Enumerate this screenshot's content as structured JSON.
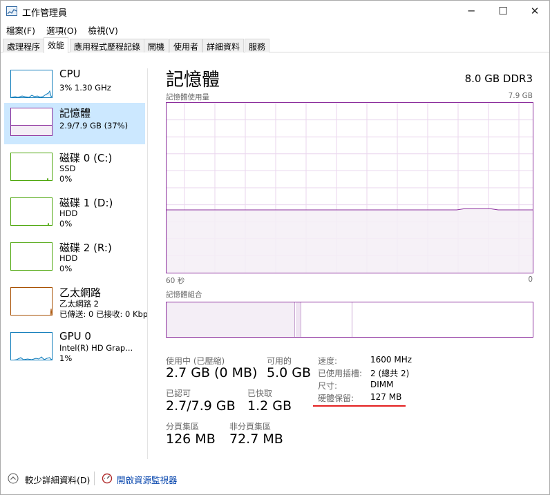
{
  "window": {
    "title": "工作管理員",
    "minimize_glyph": "─",
    "maximize_glyph": "☐",
    "close_glyph": "✕"
  },
  "menu": [
    {
      "label": "檔案(F)"
    },
    {
      "label": "選項(O)"
    },
    {
      "label": "檢視(V)"
    }
  ],
  "tabs": [
    {
      "label": "處理程序"
    },
    {
      "label": "效能"
    },
    {
      "label": "應用程式歷程記錄"
    },
    {
      "label": "開機"
    },
    {
      "label": "使用者"
    },
    {
      "label": "詳細資料"
    },
    {
      "label": "服務"
    }
  ],
  "active_tab": "效能",
  "sidebar": {
    "items": [
      {
        "name": "CPU",
        "line1": "3%  1.30 GHz",
        "line2": "",
        "color": "#117dbb"
      },
      {
        "name": "記憶體",
        "line1": "2.9/7.9 GB (37%)",
        "line2": "",
        "color": "#8b2d9c"
      },
      {
        "name": "磁碟 0 (C:)",
        "line1": "SSD",
        "line2": "0%",
        "color": "#4da60c"
      },
      {
        "name": "磁碟 1 (D:)",
        "line1": "HDD",
        "line2": "0%",
        "color": "#4da60c"
      },
      {
        "name": "磁碟 2 (R:)",
        "line1": "HDD",
        "line2": "0%",
        "color": "#4da60c"
      },
      {
        "name": "乙太網路",
        "line1": "乙太網路 2",
        "line2": "已傳送: 0  已接收: 0 Kbps",
        "color": "#a74f01"
      },
      {
        "name": "GPU 0",
        "line1": "Intel(R) HD Grap...",
        "line2": "1%",
        "color": "#117dbb"
      }
    ]
  },
  "main": {
    "title": "記憶體",
    "spec": "8.0 GB DDR3",
    "usage_label": "記憶體使用量",
    "usage_max": "7.9 GB",
    "time_left": "60 秒",
    "time_right": "0",
    "composition_label": "記憶體組合",
    "usage_fraction": 0.37
  },
  "stats": {
    "in_use_label": "使用中 (已壓縮)",
    "in_use_value": "2.7 GB (0 MB)",
    "available_label": "可用的",
    "available_value": "5.0 GB",
    "committed_label": "已認可",
    "committed_value": "2.7/7.9 GB",
    "cached_label": "已快取",
    "cached_value": "1.2 GB",
    "paged_label": "分頁集區",
    "paged_value": "126 MB",
    "nonpaged_label": "非分頁集區",
    "nonpaged_value": "72.7 MB"
  },
  "details": [
    {
      "key": "速度:",
      "value": "1600 MHz"
    },
    {
      "key": "已使用插槽:",
      "value": "2 (總共 2)"
    },
    {
      "key": "尺寸:",
      "value": "DIMM"
    },
    {
      "key": "硬體保留:",
      "value": "127 MB"
    }
  ],
  "footer": {
    "fewer_details": "較少詳細資料(D)",
    "resource_monitor": "開啟資源監視器"
  },
  "colors": {
    "memory": "#8b2d9c",
    "memory_fill": "#f4eef6",
    "grid": "#ead6ee",
    "selection": "#cce8ff",
    "highlight": "#e32020"
  }
}
